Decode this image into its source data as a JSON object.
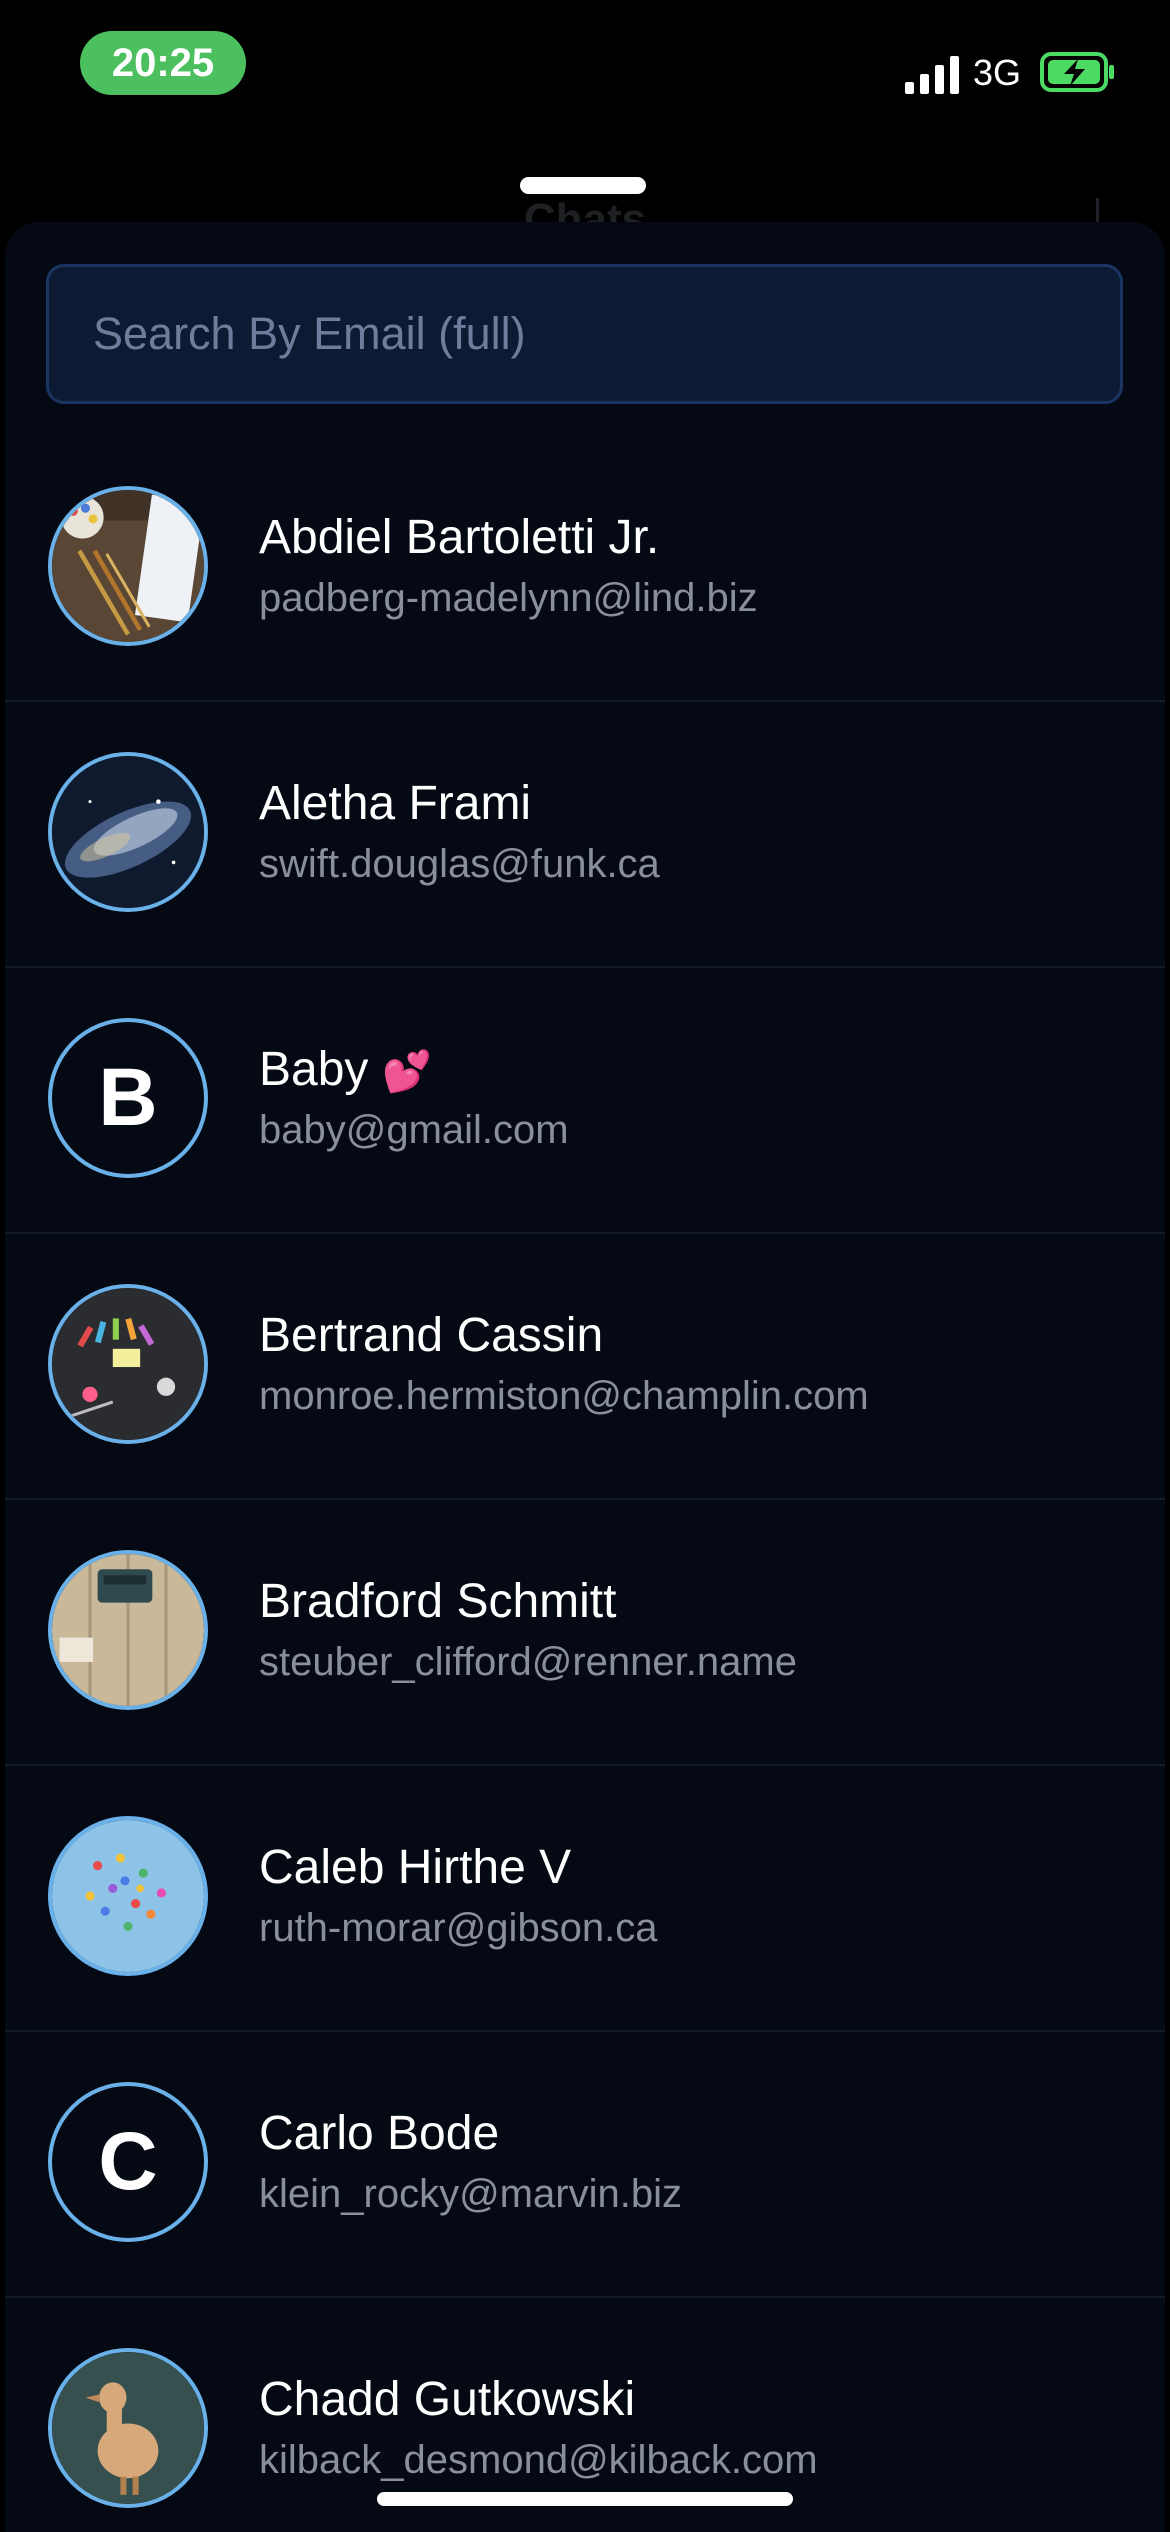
{
  "status_bar": {
    "time": "20:25",
    "network": "3G",
    "signal_icon": "signal-bars-icon",
    "battery_icon": "battery-charging-icon",
    "time_pill_color": "#4cc05f",
    "battery_color": "#4cd964"
  },
  "background_screen": {
    "title": "Chats"
  },
  "search": {
    "placeholder": "Search By Email (full)"
  },
  "contacts": [
    {
      "name": "Abdiel Bartoletti Jr.",
      "email": "padberg-madelynn@lind.biz",
      "avatar": "photo",
      "avatar_icon": "art-supplies-photo"
    },
    {
      "name": "Aletha Frami",
      "email": "swift.douglas@funk.ca",
      "avatar": "photo",
      "avatar_icon": "galaxy-photo"
    },
    {
      "name": "Baby",
      "emoji": "💕",
      "email": "baby@gmail.com",
      "avatar": "initial",
      "initial": "B"
    },
    {
      "name": "Bertrand Cassin",
      "email": "monroe.hermiston@champlin.com",
      "avatar": "photo",
      "avatar_icon": "desk-tools-photo"
    },
    {
      "name": "Bradford Schmitt",
      "email": "steuber_clifford@renner.name",
      "avatar": "photo",
      "avatar_icon": "typewriter-photo"
    },
    {
      "name": "Caleb Hirthe V",
      "email": "ruth-morar@gibson.ca",
      "avatar": "photo",
      "avatar_icon": "confetti-photo"
    },
    {
      "name": "Carlo Bode",
      "email": "klein_rocky@marvin.biz",
      "avatar": "initial",
      "initial": "C"
    },
    {
      "name": "Chadd Gutkowski",
      "email": "kilback_desmond@kilback.com",
      "avatar": "photo",
      "avatar_icon": "wooden-duck-photo"
    }
  ],
  "colors": {
    "sheet_background": "#050914",
    "avatar_ring": "#6ab1ea",
    "search_background": "#0c1a33",
    "search_border": "#1b3563"
  }
}
